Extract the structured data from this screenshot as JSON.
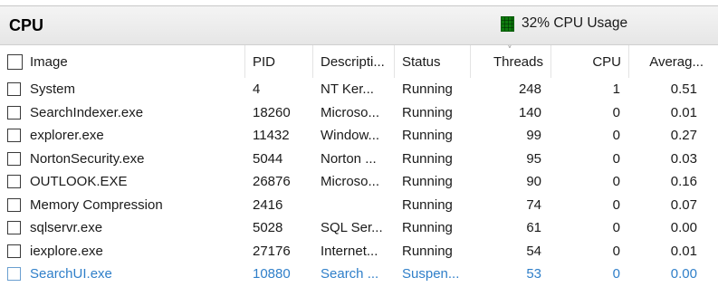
{
  "section": {
    "title": "CPU",
    "usage_text": "32% CPU Usage",
    "meter_icon": "cpu-meter-icon",
    "meter_color": "#0d7a0d"
  },
  "columns": {
    "image": "Image",
    "pid": "PID",
    "description": "Descripti...",
    "status": "Status",
    "threads": "Threads",
    "cpu": "CPU",
    "average": "Averag..."
  },
  "sort_indicator": "˅",
  "rows": [
    {
      "image": "System",
      "pid": "4",
      "description": "NT Ker...",
      "status": "Running",
      "threads": "248",
      "cpu": "1",
      "average": "0.51"
    },
    {
      "image": "SearchIndexer.exe",
      "pid": "18260",
      "description": "Microso...",
      "status": "Running",
      "threads": "140",
      "cpu": "0",
      "average": "0.01"
    },
    {
      "image": "explorer.exe",
      "pid": "11432",
      "description": "Window...",
      "status": "Running",
      "threads": "99",
      "cpu": "0",
      "average": "0.27"
    },
    {
      "image": "NortonSecurity.exe",
      "pid": "5044",
      "description": "Norton ...",
      "status": "Running",
      "threads": "95",
      "cpu": "0",
      "average": "0.03"
    },
    {
      "image": "OUTLOOK.EXE",
      "pid": "26876",
      "description": "Microso...",
      "status": "Running",
      "threads": "90",
      "cpu": "0",
      "average": "0.16"
    },
    {
      "image": "Memory Compression",
      "pid": "2416",
      "description": "",
      "status": "Running",
      "threads": "74",
      "cpu": "0",
      "average": "0.07"
    },
    {
      "image": "sqlservr.exe",
      "pid": "5028",
      "description": "SQL Ser...",
      "status": "Running",
      "threads": "61",
      "cpu": "0",
      "average": "0.00"
    },
    {
      "image": "iexplore.exe",
      "pid": "27176",
      "description": "Internet...",
      "status": "Running",
      "threads": "54",
      "cpu": "0",
      "average": "0.01"
    },
    {
      "image": "SearchUI.exe",
      "pid": "10880",
      "description": "Search ...",
      "status": "Suspen...",
      "threads": "53",
      "cpu": "0",
      "average": "0.00"
    }
  ],
  "suspended_color": "#2f7fc9"
}
